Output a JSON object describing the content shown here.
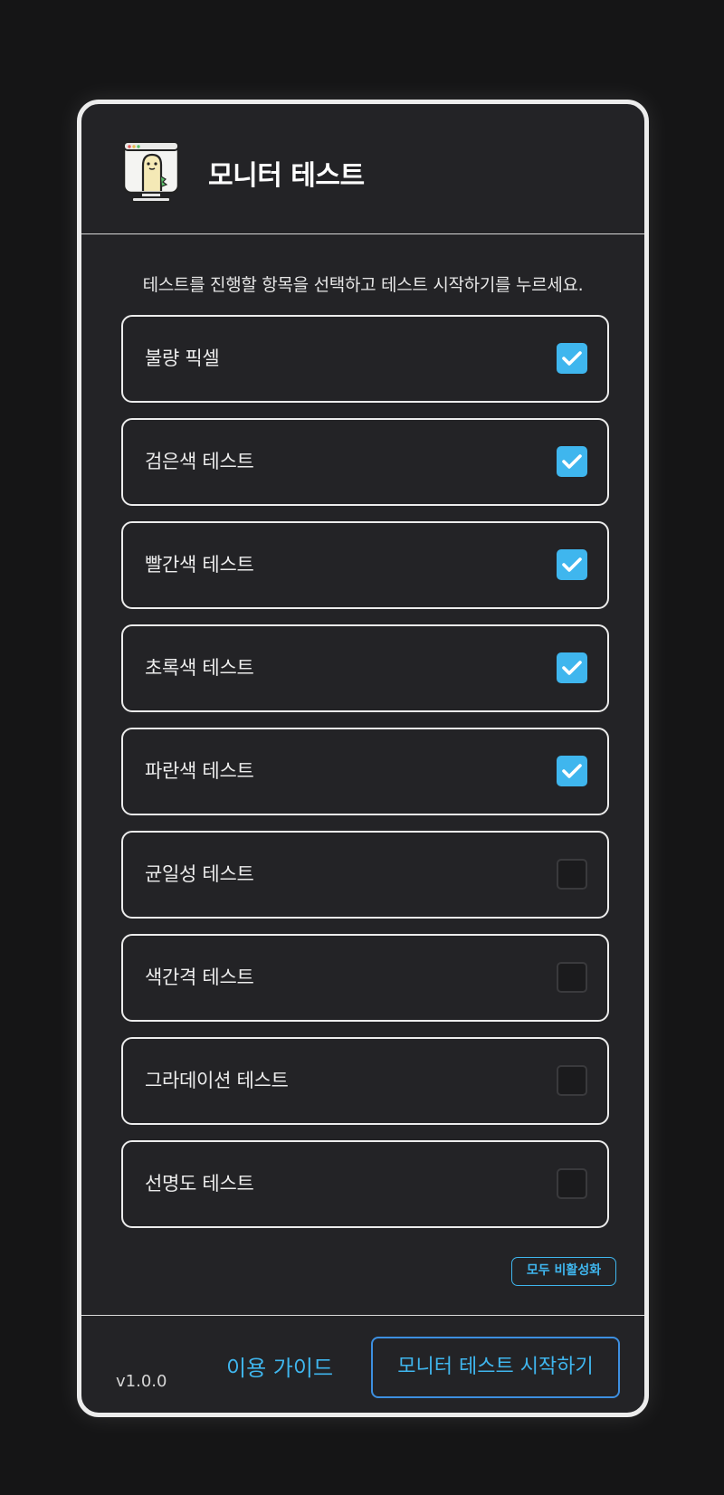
{
  "header": {
    "title": "모니터 테스트",
    "logo_icon": "monitor-character-icon"
  },
  "instruction": "테스트를 진행할 항목을 선택하고 테스트 시작하기를 누르세요.",
  "tests": [
    {
      "label": "불량 픽셀",
      "checked": true
    },
    {
      "label": "검은색 테스트",
      "checked": true
    },
    {
      "label": "빨간색 테스트",
      "checked": true
    },
    {
      "label": "초록색 테스트",
      "checked": true
    },
    {
      "label": "파란색 테스트",
      "checked": true
    },
    {
      "label": "균일성 테스트",
      "checked": false
    },
    {
      "label": "색간격 테스트",
      "checked": false
    },
    {
      "label": "그라데이션 테스트",
      "checked": false
    },
    {
      "label": "선명도 테스트",
      "checked": false
    }
  ],
  "disable_all_label": "모두 비활성화",
  "footer": {
    "version": "v1.0.0",
    "guide_label": "이용 가이드",
    "start_label": "모니터 테스트 시작하기"
  },
  "colors": {
    "accent": "#3fb6ee",
    "panel_bg": "#232326",
    "page_bg": "#151516",
    "border": "#ececec"
  }
}
